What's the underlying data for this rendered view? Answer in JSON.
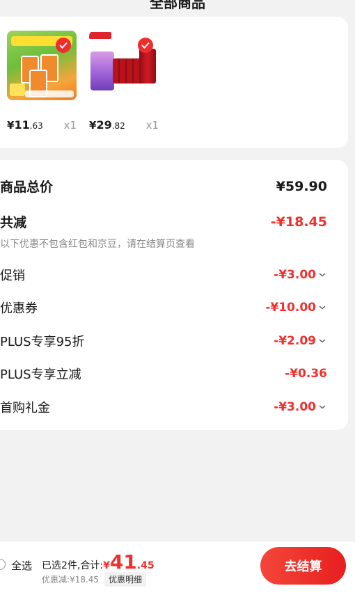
{
  "header": {
    "title": "全部商品"
  },
  "products": [
    {
      "name": "carrot-juice",
      "price_symbol": "¥",
      "price_int": "11",
      "price_dec": ".63",
      "qty": "x1"
    },
    {
      "name": "cola-pack",
      "price_symbol": "¥",
      "price_int": "29",
      "price_dec": ".82",
      "qty": "x1"
    }
  ],
  "summary": {
    "total_label": "商品总价",
    "total_value": "¥59.90",
    "reduce_label": "共减",
    "reduce_value": "-¥18.45",
    "note": "以下优惠不包含红包和京豆，请在结算页查看",
    "items": [
      {
        "label": "促销",
        "value": "-¥3.00"
      },
      {
        "label": "优惠券",
        "value": "-¥10.00"
      },
      {
        "label": "PLUS专享95折",
        "value": "-¥2.09"
      },
      {
        "label": "PLUS专享立减",
        "value": "-¥0.36"
      },
      {
        "label": "首购礼金",
        "value": "-¥3.00"
      }
    ]
  },
  "bottom": {
    "select_all": "全选",
    "selected_text": "已选2件,合计:",
    "total_symbol": "¥",
    "total_int": "41",
    "total_dec": ".45",
    "discount_text": "优惠减:¥18.45",
    "detail_label": "优惠明细",
    "checkout_label": "去结算"
  },
  "colors": {
    "accent": "#f0302c",
    "background": "#f2f2f2"
  }
}
